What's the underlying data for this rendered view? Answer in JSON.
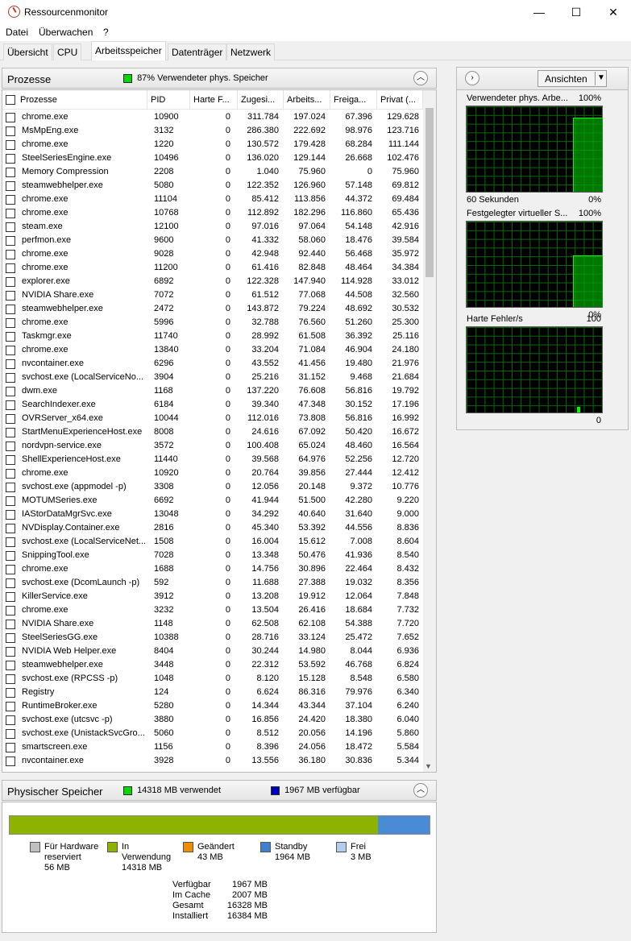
{
  "window": {
    "title": "Ressourcenmonitor",
    "min_glyph": "—",
    "max_glyph": "☐",
    "close_glyph": "✕"
  },
  "menu": [
    "Datei",
    "Überwachen",
    "?"
  ],
  "tabs": [
    "Übersicht",
    "CPU",
    "Arbeitsspeicher",
    "Datenträger",
    "Netzwerk"
  ],
  "active_tab": 2,
  "processes": {
    "title": "Prozesse",
    "summary": "87% Verwendeter phys. Speicher",
    "columns": [
      "Prozesse",
      "PID",
      "Harte F...",
      "Zugesi...",
      "Arbeits...",
      "Freiga...",
      "Privat (..."
    ],
    "rows": [
      [
        "chrome.exe",
        "10900",
        "0",
        "311.784",
        "197.024",
        "67.396",
        "129.628"
      ],
      [
        "MsMpEng.exe",
        "3132",
        "0",
        "286.380",
        "222.692",
        "98.976",
        "123.716"
      ],
      [
        "chrome.exe",
        "1220",
        "0",
        "130.572",
        "179.428",
        "68.284",
        "111.144"
      ],
      [
        "SteelSeriesEngine.exe",
        "10496",
        "0",
        "136.020",
        "129.144",
        "26.668",
        "102.476"
      ],
      [
        "Memory Compression",
        "2208",
        "0",
        "1.040",
        "75.960",
        "0",
        "75.960"
      ],
      [
        "steamwebhelper.exe",
        "5080",
        "0",
        "122.352",
        "126.960",
        "57.148",
        "69.812"
      ],
      [
        "chrome.exe",
        "11104",
        "0",
        "85.412",
        "113.856",
        "44.372",
        "69.484"
      ],
      [
        "chrome.exe",
        "10768",
        "0",
        "112.892",
        "182.296",
        "116.860",
        "65.436"
      ],
      [
        "steam.exe",
        "12100",
        "0",
        "97.016",
        "97.064",
        "54.148",
        "42.916"
      ],
      [
        "perfmon.exe",
        "9600",
        "0",
        "41.332",
        "58.060",
        "18.476",
        "39.584"
      ],
      [
        "chrome.exe",
        "9028",
        "0",
        "42.948",
        "92.440",
        "56.468",
        "35.972"
      ],
      [
        "chrome.exe",
        "11200",
        "0",
        "61.416",
        "82.848",
        "48.464",
        "34.384"
      ],
      [
        "explorer.exe",
        "6892",
        "0",
        "122.328",
        "147.940",
        "114.928",
        "33.012"
      ],
      [
        "NVIDIA Share.exe",
        "7072",
        "0",
        "61.512",
        "77.068",
        "44.508",
        "32.560"
      ],
      [
        "steamwebhelper.exe",
        "2472",
        "0",
        "143.872",
        "79.224",
        "48.692",
        "30.532"
      ],
      [
        "chrome.exe",
        "5996",
        "0",
        "32.788",
        "76.560",
        "51.260",
        "25.300"
      ],
      [
        "Taskmgr.exe",
        "11740",
        "0",
        "28.992",
        "61.508",
        "36.392",
        "25.116"
      ],
      [
        "chrome.exe",
        "13840",
        "0",
        "33.204",
        "71.084",
        "46.904",
        "24.180"
      ],
      [
        "nvcontainer.exe",
        "6296",
        "0",
        "43.552",
        "41.456",
        "19.480",
        "21.976"
      ],
      [
        "svchost.exe (LocalServiceNo...",
        "3904",
        "0",
        "25.216",
        "31.152",
        "9.468",
        "21.684"
      ],
      [
        "dwm.exe",
        "1168",
        "0",
        "137.220",
        "76.608",
        "56.816",
        "19.792"
      ],
      [
        "SearchIndexer.exe",
        "6184",
        "0",
        "39.340",
        "47.348",
        "30.152",
        "17.196"
      ],
      [
        "OVRServer_x64.exe",
        "10044",
        "0",
        "112.016",
        "73.808",
        "56.816",
        "16.992"
      ],
      [
        "StartMenuExperienceHost.exe",
        "8008",
        "0",
        "24.616",
        "67.092",
        "50.420",
        "16.672"
      ],
      [
        "nordvpn-service.exe",
        "3572",
        "0",
        "100.408",
        "65.024",
        "48.460",
        "16.564"
      ],
      [
        "ShellExperienceHost.exe",
        "11440",
        "0",
        "39.568",
        "64.976",
        "52.256",
        "12.720"
      ],
      [
        "chrome.exe",
        "10920",
        "0",
        "20.764",
        "39.856",
        "27.444",
        "12.412"
      ],
      [
        "svchost.exe (appmodel -p)",
        "3308",
        "0",
        "12.056",
        "20.148",
        "9.372",
        "10.776"
      ],
      [
        "MOTUMSeries.exe",
        "6692",
        "0",
        "41.944",
        "51.500",
        "42.280",
        "9.220"
      ],
      [
        "IAStorDataMgrSvc.exe",
        "13048",
        "0",
        "34.292",
        "40.640",
        "31.640",
        "9.000"
      ],
      [
        "NVDisplay.Container.exe",
        "2816",
        "0",
        "45.340",
        "53.392",
        "44.556",
        "8.836"
      ],
      [
        "svchost.exe (LocalServiceNet...",
        "1508",
        "0",
        "16.004",
        "15.612",
        "7.008",
        "8.604"
      ],
      [
        "SnippingTool.exe",
        "7028",
        "0",
        "13.348",
        "50.476",
        "41.936",
        "8.540"
      ],
      [
        "chrome.exe",
        "1688",
        "0",
        "14.756",
        "30.896",
        "22.464",
        "8.432"
      ],
      [
        "svchost.exe (DcomLaunch -p)",
        "592",
        "0",
        "11.688",
        "27.388",
        "19.032",
        "8.356"
      ],
      [
        "KillerService.exe",
        "3912",
        "0",
        "13.208",
        "19.912",
        "12.064",
        "7.848"
      ],
      [
        "chrome.exe",
        "3232",
        "0",
        "13.504",
        "26.416",
        "18.684",
        "7.732"
      ],
      [
        "NVIDIA Share.exe",
        "1148",
        "0",
        "62.508",
        "62.108",
        "54.388",
        "7.720"
      ],
      [
        "SteelSeriesGG.exe",
        "10388",
        "0",
        "28.716",
        "33.124",
        "25.472",
        "7.652"
      ],
      [
        "NVIDIA Web Helper.exe",
        "8404",
        "0",
        "30.244",
        "14.980",
        "8.044",
        "6.936"
      ],
      [
        "steamwebhelper.exe",
        "3448",
        "0",
        "22.312",
        "53.592",
        "46.768",
        "6.824"
      ],
      [
        "svchost.exe (RPCSS -p)",
        "1048",
        "0",
        "8.120",
        "15.128",
        "8.548",
        "6.580"
      ],
      [
        "Registry",
        "124",
        "0",
        "6.624",
        "86.316",
        "79.976",
        "6.340"
      ],
      [
        "RuntimeBroker.exe",
        "5280",
        "0",
        "14.344",
        "43.344",
        "37.104",
        "6.240"
      ],
      [
        "svchost.exe (utcsvc -p)",
        "3880",
        "0",
        "16.856",
        "24.420",
        "18.380",
        "6.040"
      ],
      [
        "svchost.exe (UnistackSvcGro...",
        "5060",
        "0",
        "8.512",
        "20.056",
        "14.196",
        "5.860"
      ],
      [
        "smartscreen.exe",
        "1156",
        "0",
        "8.396",
        "24.056",
        "18.472",
        "5.584"
      ],
      [
        "nvcontainer.exe",
        "3928",
        "0",
        "13.556",
        "36.180",
        "30.836",
        "5.344"
      ]
    ]
  },
  "physical": {
    "title": "Physischer Speicher",
    "used_label": "14318 MB verwendet",
    "free_label": "1967 MB verfügbar",
    "used_fraction": 0.877,
    "legend": [
      {
        "line1": "Für Hardware",
        "line2": "reserviert",
        "line3": "56 MB",
        "color": "#c0c0c0"
      },
      {
        "line1": "In",
        "line2": "Verwendung",
        "line3": "14318 MB",
        "color": "#8db300"
      },
      {
        "line1": "Geändert",
        "line2": "43 MB",
        "line3": "",
        "color": "#ef8c00"
      },
      {
        "line1": "Standby",
        "line2": "1964 MB",
        "line3": "",
        "color": "#3e7fd0"
      },
      {
        "line1": "Frei",
        "line2": "3 MB",
        "line3": "",
        "color": "#b2ccee"
      }
    ],
    "stats": [
      {
        "label": "Verfügbar",
        "value": "1967 MB"
      },
      {
        "label": "Im Cache",
        "value": "2007 MB"
      },
      {
        "label": "Gesamt",
        "value": "16328 MB"
      },
      {
        "label": "Installiert",
        "value": "16384 MB"
      }
    ]
  },
  "right_panel": {
    "views_button": "Ansichten",
    "graphs": [
      {
        "title": "Verwendeter phys. Arbe...",
        "max": "100%",
        "left_foot": "60 Sekunden",
        "right_foot": "0%",
        "level": 0.87
      },
      {
        "title": "Festgelegter virtueller S...",
        "max": "100%",
        "left_foot": "",
        "right_foot": "0%",
        "level": 0.6
      },
      {
        "title": "Harte Fehler/s",
        "max": "100",
        "left_foot": "",
        "right_foot": "0",
        "level": 0.0
      }
    ]
  },
  "colors": {
    "used": "#00d800",
    "available": "#0000b8",
    "graph_line": "#00ff00"
  }
}
